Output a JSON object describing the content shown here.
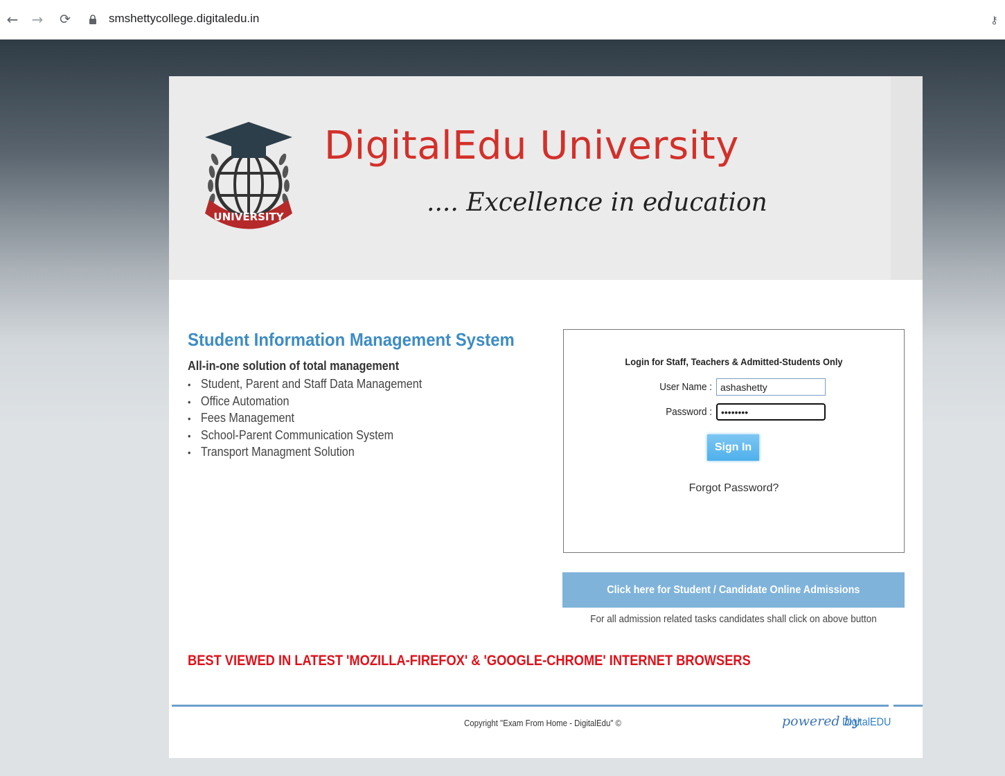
{
  "browser": {
    "url": "smshettycollege.digitaledu.in"
  },
  "header": {
    "university_name": "DigitalEdu University",
    "tagline": ".... Excellence in education",
    "logo_text": "UNIVERSITY"
  },
  "info": {
    "title": "Student Information Management System",
    "subtitle": "All-in-one solution of total management",
    "features": [
      "Student, Parent and Staff Data Management",
      "Office Automation",
      "Fees Management",
      "School-Parent Communication System",
      "Transport Managment Solution"
    ]
  },
  "login": {
    "title": "Login for Staff, Teachers & Admitted-Students Only",
    "username_label": "User Name :",
    "username_value": "ashashetty",
    "password_label": "Password :",
    "password_value": "••••••••",
    "signin_label": "Sign In",
    "forgot_label": "Forgot Password?"
  },
  "admission": {
    "button_label": "Click here for Student / Candidate Online Admissions",
    "note": "For all admission related tasks candidates shall click on above button"
  },
  "browser_note": "BEST VIEWED IN LATEST 'MOZILLA-FIREFOX' & 'GOOGLE-CHROME' INTERNET BROWSERS",
  "footer": {
    "copyright": "Copyright \"Exam From Home - DigitalEdu\" ©",
    "powered_prefix": "powered by",
    "powered_brand": "DigitalEDU"
  },
  "colors": {
    "brand_red": "#d3302a",
    "title_blue": "#3d8cc4",
    "button_blue": "#4fb0ec",
    "admission_blue": "#7fb3da",
    "warning_red": "#e0111a"
  }
}
